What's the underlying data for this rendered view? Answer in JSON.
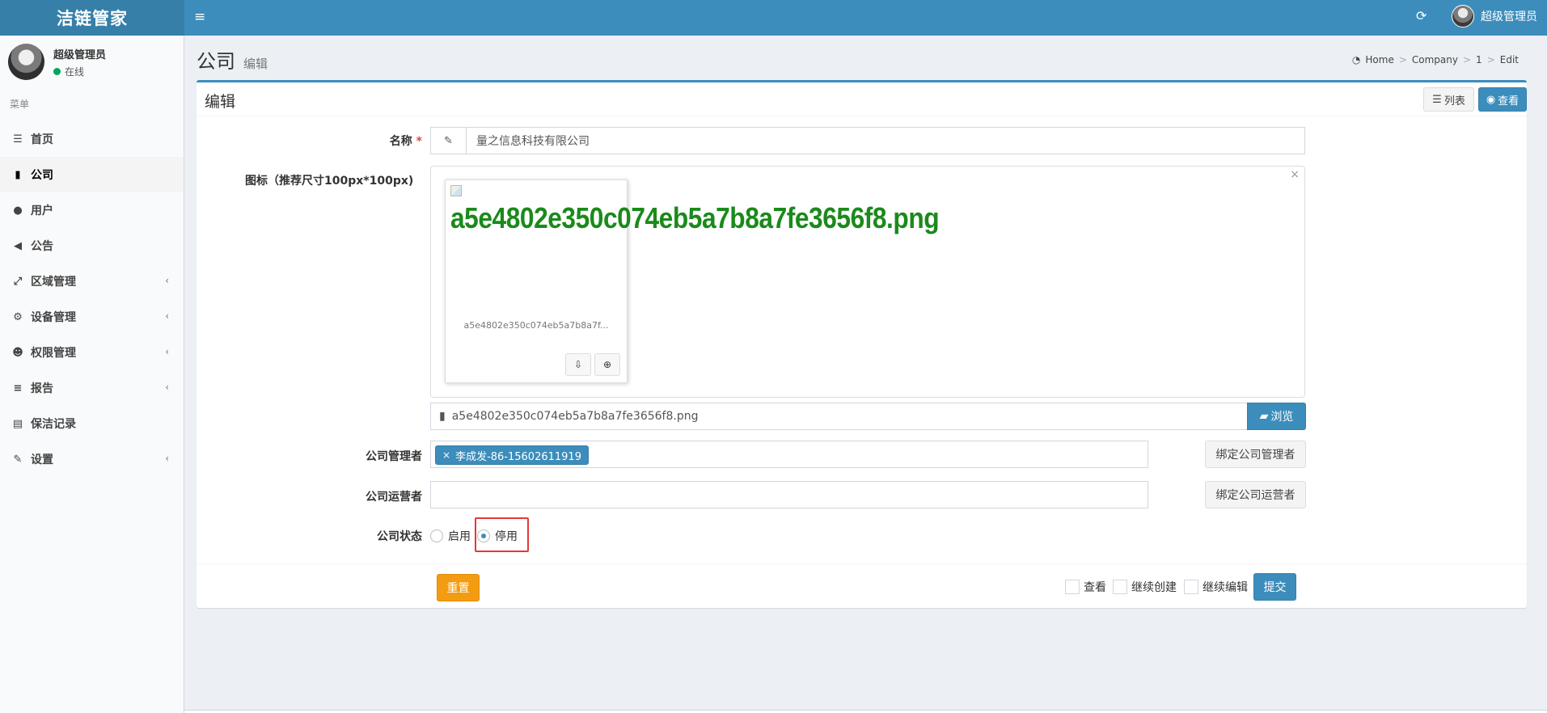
{
  "app": {
    "logo": "洁链管家",
    "menu_toggle_icon": "≡",
    "refresh_icon": "⟳",
    "user_name": "超级管理员"
  },
  "sidebar": {
    "user_name": "超级管理员",
    "status": "在线",
    "status_color": "#00a65a",
    "menu_header": "菜单",
    "items": [
      {
        "label": "首页",
        "icon": "list-icon",
        "glyph": "☰",
        "has_submenu": false,
        "active": false
      },
      {
        "label": "公司",
        "icon": "building-icon",
        "glyph": "▮",
        "has_submenu": false,
        "active": true
      },
      {
        "label": "用户",
        "icon": "user-icon",
        "glyph": "●",
        "has_submenu": false,
        "active": false
      },
      {
        "label": "公告",
        "icon": "bullhorn-icon",
        "glyph": "◀",
        "has_submenu": false,
        "active": false
      },
      {
        "label": "区域管理",
        "icon": "expand-arrows-icon",
        "glyph": "⤢",
        "has_submenu": true,
        "active": false
      },
      {
        "label": "设备管理",
        "icon": "gears-icon",
        "glyph": "⚙",
        "has_submenu": true,
        "active": false
      },
      {
        "label": "权限管理",
        "icon": "users-icon",
        "glyph": "☻",
        "has_submenu": true,
        "active": false
      },
      {
        "label": "报告",
        "icon": "bars-icon",
        "glyph": "≡",
        "has_submenu": true,
        "active": false
      },
      {
        "label": "保洁记录",
        "icon": "book-icon",
        "glyph": "▤",
        "has_submenu": false,
        "active": false
      },
      {
        "label": "设置",
        "icon": "wrench-icon",
        "glyph": "✎",
        "has_submenu": true,
        "active": false
      }
    ],
    "chevron": "‹"
  },
  "header": {
    "title": "公司",
    "subtitle": "编辑",
    "breadcrumb": [
      "Home",
      "Company",
      "1",
      "Edit"
    ],
    "breadcrumb_sep": ">"
  },
  "box": {
    "title": "编辑",
    "list_label": "列表",
    "view_label": "查看"
  },
  "form": {
    "name_label": "名称",
    "required_mark": "*",
    "name_value": "量之信息科技有限公司",
    "icon_label": "图标（推荐尺寸100px*100px)",
    "preview_close": "×",
    "preview_alt": "a5e4802e350c074eb5a7b8a7fe3656f8.png",
    "preview_caption": "a5e4802e350c074eb5a7b8a7f...",
    "file_caption": "a5e4802e350c074eb5a7b8a7fe3656f8.png",
    "browse_label": "浏览",
    "manager_label": "公司管理者",
    "manager_tag": "李成发-86-15602611919",
    "manager_tag_remove": "×",
    "bind_manager_label": "绑定公司管理者",
    "operator_label": "公司运营者",
    "operator_value": "",
    "bind_operator_label": "绑定公司运营者",
    "status_label": "公司状态",
    "status_options": [
      "启用",
      "停用"
    ],
    "status_selected": "停用"
  },
  "footer": {
    "reset_label": "重置",
    "check_view": "查看",
    "check_continue_create": "继续创建",
    "check_continue_edit": "继续编辑",
    "submit_label": "提交"
  },
  "colors": {
    "brand": "#3c8dbc",
    "logo_bg": "#367fa9",
    "warning": "#f39c12",
    "danger": "#dd4b39",
    "highlight": "#e53935",
    "alt_text": "#1a8a1a"
  }
}
